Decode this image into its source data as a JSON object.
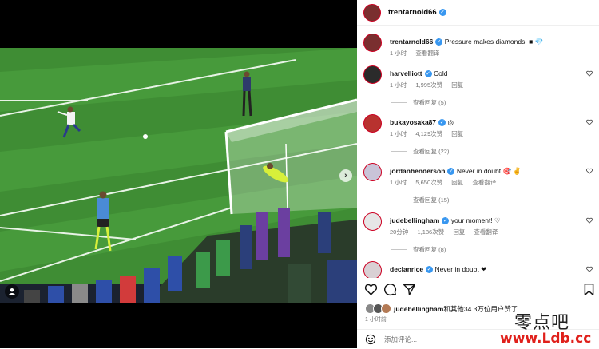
{
  "post": {
    "author": "trentarnold66",
    "caption_user": "trentarnold66",
    "caption_text": "Pressure makes diamonds.",
    "caption_emojis": "■ 💎",
    "caption_time": "1 小时",
    "caption_translate": "查看翻译"
  },
  "comments": [
    {
      "user": "harvelliott",
      "text": "Cold",
      "time": "1 小时",
      "likes": "1,995次赞",
      "reply": "回复",
      "translate": "",
      "view_replies": "查看回复 (5)"
    },
    {
      "user": "bukayosaka87",
      "text": "◎",
      "time": "1 小时",
      "likes": "4,129次赞",
      "reply": "回复",
      "translate": "",
      "view_replies": "查看回复 (22)"
    },
    {
      "user": "jordanhenderson",
      "text": "Never in doubt 🎯 ✌",
      "time": "1 小时",
      "likes": "5,650次赞",
      "reply": "回复",
      "translate": "查看翻译",
      "view_replies": "查看回复 (15)"
    },
    {
      "user": "judebellingham",
      "text": "your moment! ♡",
      "time": "20分钟",
      "likes": "1,186次赞",
      "reply": "回复",
      "translate": "查看翻译",
      "view_replies": "查看回复 (8)"
    },
    {
      "user": "declanrice",
      "text": "Never in doubt ❤",
      "time": "",
      "likes": "",
      "reply": "",
      "translate": "",
      "view_replies": ""
    }
  ],
  "likes_line": {
    "user": "judebellingham",
    "rest": "和其他34.3万位用户赞了"
  },
  "posted_time": "1 小时前",
  "add_comment_placeholder": "添加评论...",
  "watermark": {
    "line1": "零点吧",
    "line2": "www.Ldb.cc"
  },
  "colors": {
    "verified": "#3897f0",
    "watermark_red": "#e0201b",
    "pitch": "#3f8d34"
  },
  "icons": [
    "user-tag-icon",
    "next-arrow-icon",
    "heart-icon",
    "comment-icon",
    "share-icon",
    "bookmark-icon",
    "emoji-icon"
  ]
}
